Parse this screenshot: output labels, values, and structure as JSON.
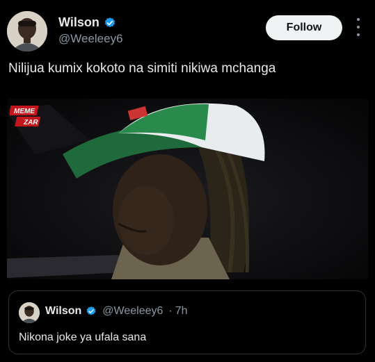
{
  "author": {
    "display_name": "Wilson",
    "handle": "@Weeleey6",
    "badge_icon": "apple-icon",
    "verified_icon": "verified-badge-icon"
  },
  "actions": {
    "follow_label": "Follow",
    "more_icon": "more-options-icon"
  },
  "tweet": {
    "text": "Nilijua kumix kokoto na simiti nikiwa mchanga",
    "media_logo_line1": "MEME",
    "media_logo_line2": "ZAR"
  },
  "quoted_tweet": {
    "display_name": "Wilson",
    "handle": "@Weeleey6",
    "dot": "·",
    "time": "7h",
    "text": "Nikona joke ya ufala sana"
  },
  "colors": {
    "background": "#000000",
    "text": "#e7e9ea",
    "secondary_text": "#8b98a5",
    "verified_blue": "#1d9bf0",
    "follow_bg": "#eff3f4",
    "border": "#2f3336"
  }
}
